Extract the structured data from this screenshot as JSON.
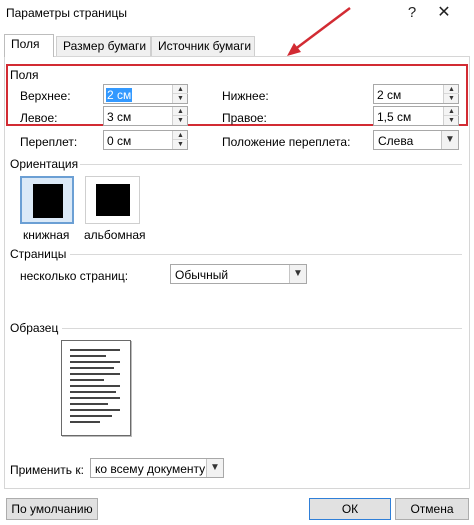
{
  "window": {
    "title": "Параметры страницы",
    "help_glyph": "?",
    "close_glyph": "✕"
  },
  "tabs": [
    {
      "label": "Поля",
      "active": true
    },
    {
      "label": "Размер бумаги",
      "active": false
    },
    {
      "label": "Источник бумаги",
      "active": false
    }
  ],
  "margins": {
    "section_title": "Поля",
    "top": {
      "label": "Верхнее:",
      "value": "2 см"
    },
    "bottom": {
      "label": "Нижнее:",
      "value": "2 см"
    },
    "left": {
      "label": "Левое:",
      "value": "3 см"
    },
    "right": {
      "label": "Правое:",
      "value": "1,5 см"
    },
    "gutter": {
      "label": "Переплет:",
      "value": "0 см"
    },
    "gutter_position": {
      "label": "Положение переплета:",
      "value": "Слева"
    }
  },
  "orientation": {
    "section_title": "Ориентация",
    "portrait_label": "книжная",
    "landscape_label": "альбомная",
    "selected": "portrait"
  },
  "pages": {
    "section_title": "Страницы",
    "multiple_pages_label": "несколько страниц:",
    "multiple_pages_value": "Обычный"
  },
  "preview": {
    "section_title": "Образец"
  },
  "apply_to": {
    "label": "Применить к:",
    "value": "ко всему документу"
  },
  "buttons": {
    "default_label": "По умолчанию",
    "ok_label": "ОК",
    "cancel_label": "Отмена"
  },
  "annotation": {
    "highlight_color": "#d22b33",
    "arrow_color": "#d22b33"
  }
}
